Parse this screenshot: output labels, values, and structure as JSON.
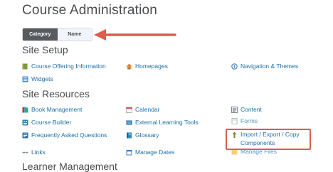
{
  "page": {
    "title": "Course Administration"
  },
  "view_toggle": {
    "category": "Category",
    "name": "Name",
    "active": "Category"
  },
  "annotation": {
    "arrow_color": "#e05a4e",
    "highlight_color": "#e05a4e"
  },
  "sections": {
    "site_setup": {
      "heading": "Site Setup",
      "links": {
        "course_offering": {
          "label": "Course Offering Information",
          "icon": "book-icon"
        },
        "homepages": {
          "label": "Homepages",
          "icon": "home-icon"
        },
        "navigation": {
          "label": "Navigation & Themes",
          "icon": "compass-icon"
        },
        "widgets": {
          "label": "Widgets",
          "icon": "widget-icon"
        }
      }
    },
    "site_resources": {
      "heading": "Site Resources",
      "links": {
        "book_management": {
          "label": "Book Management",
          "icon": "books-icon"
        },
        "calendar": {
          "label": "Calendar",
          "icon": "calendar-icon"
        },
        "content": {
          "label": "Content",
          "icon": "content-icon"
        },
        "course_builder": {
          "label": "Course Builder",
          "icon": "builder-icon"
        },
        "external_tools": {
          "label": "External Learning Tools",
          "icon": "tools-icon"
        },
        "forms": {
          "label": "Forms",
          "icon": "forms-icon"
        },
        "faq": {
          "label": "Frequently Asked Questions",
          "icon": "faq-icon"
        },
        "glossary": {
          "label": "Glossary",
          "icon": "glossary-icon"
        },
        "import_export": {
          "label": "Import / Export / Copy Components",
          "icon": "import-export-icon"
        },
        "links": {
          "label": "Links",
          "icon": "link-icon"
        },
        "manage_dates": {
          "label": "Manage Dates",
          "icon": "dates-icon"
        },
        "manage_files": {
          "label": "Manage Files",
          "icon": "files-icon"
        }
      }
    },
    "learner_management": {
      "heading": "Learner Management"
    }
  },
  "colors": {
    "link": "#1c6ea8",
    "text": "#494c4e",
    "toggle_active": "#565a5c"
  }
}
